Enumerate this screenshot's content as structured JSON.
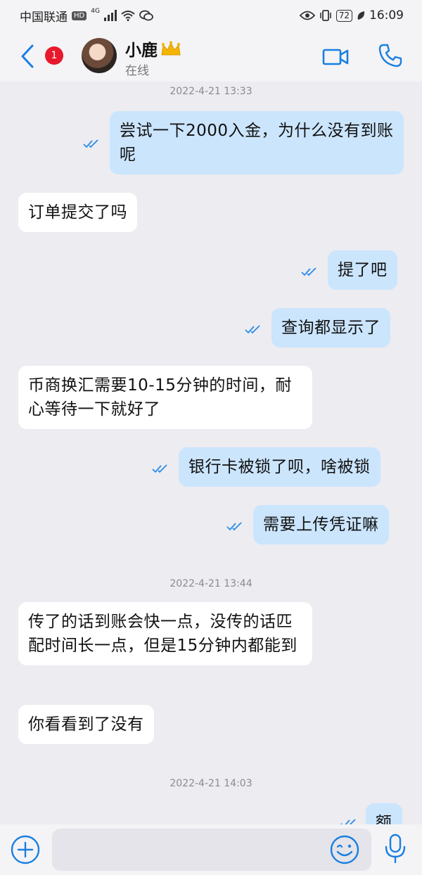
{
  "status_bar": {
    "carrier": "中国联通",
    "hd": "HD",
    "network": "4G",
    "battery": "72",
    "time": "16:09"
  },
  "header": {
    "unread_count": "1",
    "contact_name": "小鹿",
    "status": "在线"
  },
  "messages": {
    "ts1": "2022-4-21 13:33",
    "m1": "尝试一下2000入金，为什么没有到账呢",
    "m2": "订单提交了吗",
    "m3": "提了吧",
    "m4": "查询都显示了",
    "m5": "币商换汇需要10-15分钟的时间，耐心等待一下就好了",
    "m6": "银行卡被锁了呗，啥被锁",
    "m7": "需要上传凭证嘛",
    "ts2": "2022-4-21 13:44",
    "m8": "传了的话到账会快一点，没传的话匹配时间长一点，但是15分钟内都能到",
    "m9": "你看看到了没有",
    "ts3": "2022-4-21 14:03",
    "m10": "额"
  },
  "colors": {
    "accent": "#1a7fe0",
    "outgoing_bubble": "#cbe5fd",
    "incoming_bubble": "#ffffff",
    "badge": "#e8192c"
  },
  "icons": {
    "back": "back-chevron-icon",
    "video": "video-call-icon",
    "phone": "phone-call-icon",
    "plus": "plus-icon",
    "emoji": "emoji-icon",
    "mic": "microphone-icon"
  }
}
